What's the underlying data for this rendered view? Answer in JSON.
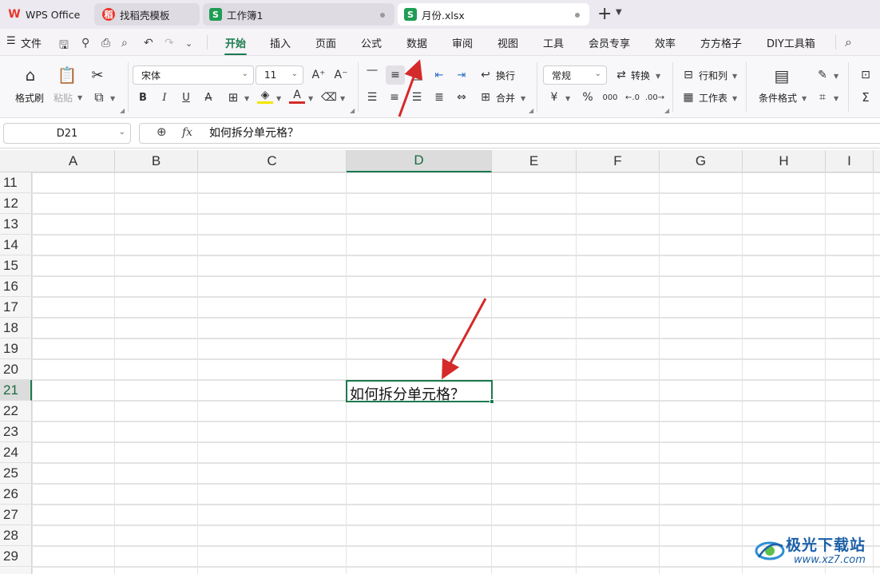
{
  "tabs": [
    {
      "label": "WPS Office",
      "icon": "wps-logo-icon"
    },
    {
      "label": "找稻壳模板",
      "icon": "docer-icon"
    },
    {
      "label": "工作簿1",
      "icon": "sheet-icon"
    },
    {
      "label": "月份.xlsx",
      "icon": "sheet-icon"
    }
  ],
  "tab_add_label": "+",
  "menu": {
    "file_label": "文件",
    "tabs": [
      "开始",
      "插入",
      "页面",
      "公式",
      "数据",
      "审阅",
      "视图",
      "工具",
      "会员专享",
      "效率",
      "方方格子",
      "DIY工具箱"
    ],
    "selected": "开始"
  },
  "ribbon": {
    "format_painter": "格式刷",
    "paste": "粘贴",
    "font_name": "宋体",
    "font_size": "11",
    "wrap": "换行",
    "merge": "合并",
    "number_format": "常规",
    "convert": "转换",
    "row_col": "行和列",
    "worksheet": "工作表",
    "cond_format": "条件格式",
    "currency": "¥",
    "percent": "%",
    "thousands": "000"
  },
  "formula_bar": {
    "name_box": "D21",
    "fx": "fx",
    "content": "如何拆分单元格？"
  },
  "columns": [
    "A",
    "B",
    "C",
    "D",
    "E",
    "F",
    "G",
    "H",
    "I"
  ],
  "rows": [
    "11",
    "12",
    "13",
    "14",
    "15",
    "16",
    "17",
    "18",
    "19",
    "20",
    "21",
    "22",
    "23",
    "24",
    "25",
    "26",
    "27",
    "28",
    "29"
  ],
  "selected_column": "D",
  "selected_row": "21",
  "active_cell_text": "如何拆分单元格？",
  "watermark": {
    "title": "极光下载站",
    "url": "www.xz7.com"
  },
  "colors": {
    "accent": "#1b7a4f",
    "annotation_arrow": "#d42a2a",
    "wps_red": "#e8362d",
    "sheet_green": "#1f9d55"
  }
}
